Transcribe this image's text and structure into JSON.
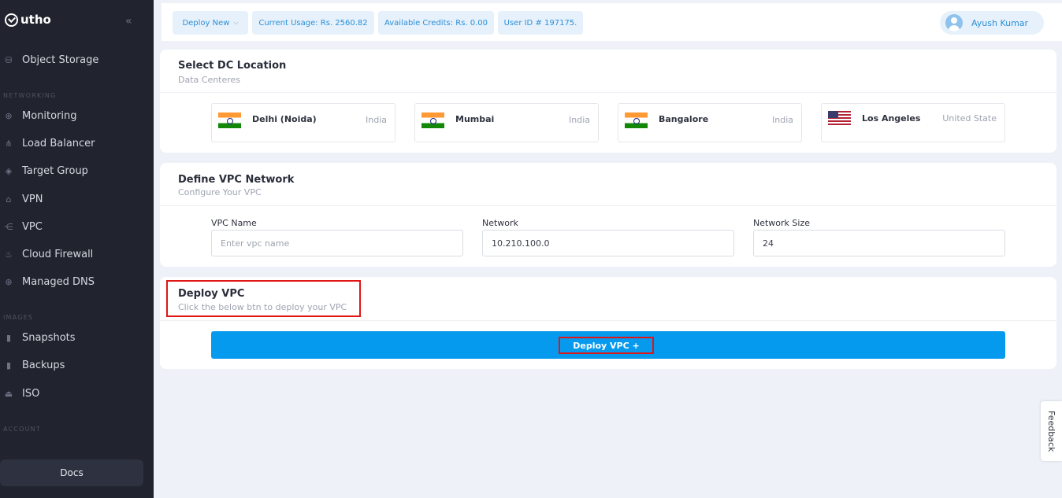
{
  "sidebar": {
    "brand": "utho",
    "collapse_glyph": "«",
    "items": [
      {
        "label": "Object Storage",
        "icon": "object-storage-icon"
      },
      {
        "label": "Monitoring",
        "icon": "globe-icon"
      },
      {
        "label": "Load Balancer",
        "icon": "network-icon"
      },
      {
        "label": "Target Group",
        "icon": "target-icon"
      },
      {
        "label": "VPN",
        "icon": "lock-icon"
      },
      {
        "label": "VPC",
        "icon": "share-icon"
      },
      {
        "label": "Cloud Firewall",
        "icon": "firewall-icon"
      },
      {
        "label": "Managed DNS",
        "icon": "globe-icon"
      },
      {
        "label": "Snapshots",
        "icon": "snapshot-icon"
      },
      {
        "label": "Backups",
        "icon": "backup-icon"
      },
      {
        "label": "ISO",
        "icon": "disc-icon"
      }
    ],
    "sections": {
      "networking": "NETWORKING",
      "images": "IMAGES",
      "account": "ACCOUNT"
    },
    "docs": "Docs"
  },
  "topbar": {
    "deploy_new": "Deploy New",
    "usage": "Current Usage: Rs. 2560.82",
    "credits": "Available Credits: Rs. 0.00",
    "user_id": "User ID # 197175.",
    "user_name": "Ayush Kumar"
  },
  "dc_section": {
    "title": "Select DC Location",
    "subtitle": "Data Centeres",
    "locations": [
      {
        "city": "Delhi (Noida)",
        "country": "India"
      },
      {
        "city": "Mumbai",
        "country": "India"
      },
      {
        "city": "Bangalore",
        "country": "India"
      },
      {
        "city": "Los Angeles",
        "country": "United State"
      }
    ]
  },
  "vpc_section": {
    "title": "Define VPC Network",
    "subtitle": "Configure Your VPC",
    "vpc_name_label": "VPC Name",
    "vpc_name_placeholder": "Enter vpc name",
    "network_label": "Network",
    "network_value": "10.210.100.0",
    "size_label": "Network Size",
    "size_value": "24"
  },
  "deploy_section": {
    "title": "Deploy VPC",
    "subtitle": "Click the below btn to deploy your VPC",
    "button": "Deploy VPC +"
  },
  "feedback": "Feedback",
  "colors": {
    "accent": "#069aef",
    "highlight": "#e01515",
    "sidebar": "#21232e"
  }
}
